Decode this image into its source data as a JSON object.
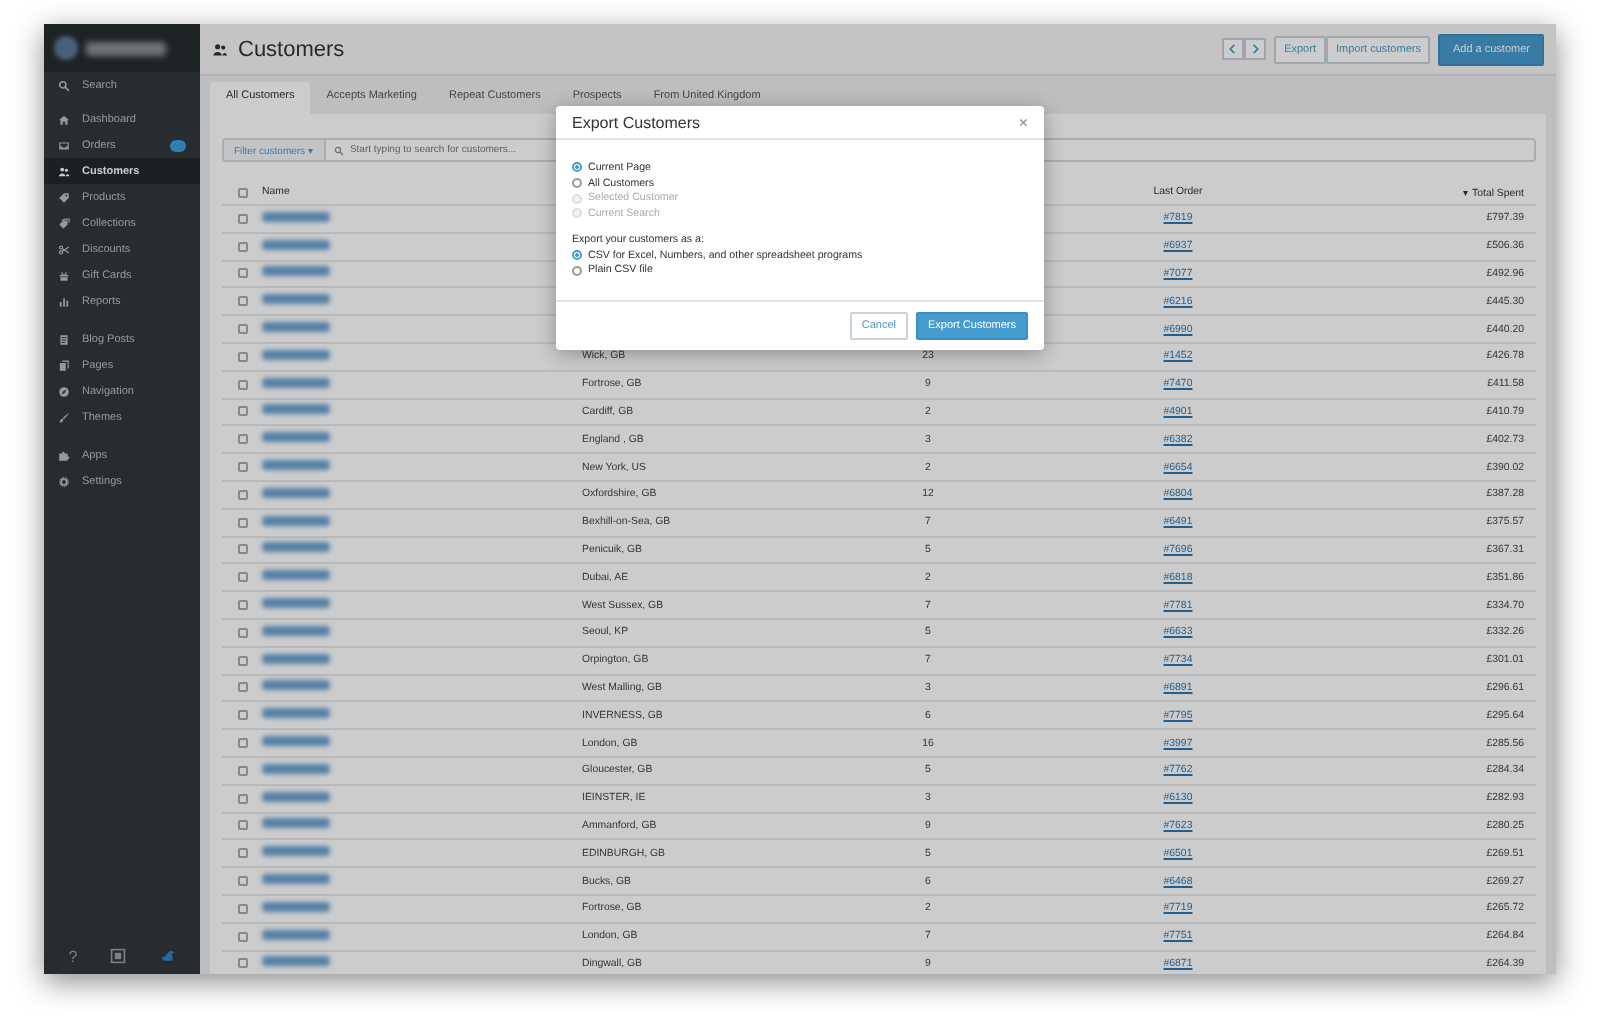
{
  "sidebar": {
    "search": "Search",
    "groups": [
      [
        {
          "label": "Dashboard",
          "selected": false,
          "badge": false
        },
        {
          "label": "Orders",
          "selected": false,
          "badge": true
        },
        {
          "label": "Customers",
          "selected": true,
          "badge": false
        },
        {
          "label": "Products",
          "selected": false,
          "badge": false
        },
        {
          "label": "Collections",
          "selected": false,
          "badge": false
        },
        {
          "label": "Discounts",
          "selected": false,
          "badge": false
        },
        {
          "label": "Gift Cards",
          "selected": false,
          "badge": false
        },
        {
          "label": "Reports",
          "selected": false,
          "badge": false
        }
      ],
      [
        {
          "label": "Blog Posts",
          "selected": false,
          "badge": false
        },
        {
          "label": "Pages",
          "selected": false,
          "badge": false
        },
        {
          "label": "Navigation",
          "selected": false,
          "badge": false
        },
        {
          "label": "Themes",
          "selected": false,
          "badge": false
        }
      ],
      [
        {
          "label": "Apps",
          "selected": false,
          "badge": false
        },
        {
          "label": "Settings",
          "selected": false,
          "badge": false
        }
      ]
    ],
    "footer_help": "?"
  },
  "header": {
    "title": "Customers",
    "buttons": [
      "Export",
      "Import customers"
    ],
    "primary_button": "Add a customer"
  },
  "tabs": [
    {
      "label": "All Customers",
      "selected": true
    },
    {
      "label": "Accepts Marketing",
      "selected": false
    },
    {
      "label": "Repeat Customers",
      "selected": false
    },
    {
      "label": "Prospects",
      "selected": false
    },
    {
      "label": "From United Kingdom",
      "selected": false
    }
  ],
  "filter": {
    "button": "Filter customers ▾",
    "placeholder": "Start typing to search for customers..."
  },
  "table": {
    "select_all_checked": false,
    "columns": [
      "Name",
      "",
      "",
      "Last Order",
      "▾ Total Spent"
    ],
    "rows": [
      {
        "checked": false,
        "location": "",
        "orders": "",
        "last_order": "#7819",
        "total": "£797.39"
      },
      {
        "checked": false,
        "location": "",
        "orders": "",
        "last_order": "#6937",
        "total": "£506.36"
      },
      {
        "checked": false,
        "location": "",
        "orders": "",
        "last_order": "#7077",
        "total": "£492.96"
      },
      {
        "checked": false,
        "location": "",
        "orders": "",
        "last_order": "#6216",
        "total": "£445.30"
      },
      {
        "checked": false,
        "location": "",
        "orders": "",
        "last_order": "#6990",
        "total": "£440.20"
      },
      {
        "checked": false,
        "location": "Wick, GB",
        "orders": "23",
        "last_order": "#1452",
        "total": "£426.78"
      },
      {
        "checked": false,
        "location": "Fortrose, GB",
        "orders": "9",
        "last_order": "#7470",
        "total": "£411.58"
      },
      {
        "checked": false,
        "location": "Cardiff, GB",
        "orders": "2",
        "last_order": "#4901",
        "total": "£410.79"
      },
      {
        "checked": false,
        "location": "England , GB",
        "orders": "3",
        "last_order": "#6382",
        "total": "£402.73"
      },
      {
        "checked": false,
        "location": "New York, US",
        "orders": "2",
        "last_order": "#6654",
        "total": "£390.02"
      },
      {
        "checked": false,
        "location": "Oxfordshire, GB",
        "orders": "12",
        "last_order": "#6804",
        "total": "£387.28"
      },
      {
        "checked": false,
        "location": "Bexhill-on-Sea, GB",
        "orders": "7",
        "last_order": "#6491",
        "total": "£375.57"
      },
      {
        "checked": false,
        "location": "Penicuik, GB",
        "orders": "5",
        "last_order": "#7696",
        "total": "£367.31"
      },
      {
        "checked": false,
        "location": "Dubai, AE",
        "orders": "2",
        "last_order": "#6818",
        "total": "£351.86"
      },
      {
        "checked": false,
        "location": "West Sussex, GB",
        "orders": "7",
        "last_order": "#7781",
        "total": "£334.70"
      },
      {
        "checked": false,
        "location": "Seoul, KP",
        "orders": "5",
        "last_order": "#6633",
        "total": "£332.26"
      },
      {
        "checked": false,
        "location": "Orpington, GB",
        "orders": "7",
        "last_order": "#7734",
        "total": "£301.01"
      },
      {
        "checked": false,
        "location": "West Malling, GB",
        "orders": "3",
        "last_order": "#6891",
        "total": "£296.61"
      },
      {
        "checked": false,
        "location": "INVERNESS, GB",
        "orders": "6",
        "last_order": "#7795",
        "total": "£295.64"
      },
      {
        "checked": false,
        "location": "London, GB",
        "orders": "16",
        "last_order": "#3997",
        "total": "£285.56"
      },
      {
        "checked": false,
        "location": "Gloucester, GB",
        "orders": "5",
        "last_order": "#7762",
        "total": "£284.34"
      },
      {
        "checked": false,
        "location": "IEINSTER, IE",
        "orders": "3",
        "last_order": "#6130",
        "total": "£282.93"
      },
      {
        "checked": false,
        "location": "Ammanford, GB",
        "orders": "9",
        "last_order": "#7623",
        "total": "£280.25"
      },
      {
        "checked": false,
        "location": "EDINBURGH, GB",
        "orders": "5",
        "last_order": "#6501",
        "total": "£269.51"
      },
      {
        "checked": false,
        "location": "Bucks, GB",
        "orders": "6",
        "last_order": "#6468",
        "total": "£269.27"
      },
      {
        "checked": false,
        "location": "Fortrose, GB",
        "orders": "2",
        "last_order": "#7719",
        "total": "£265.72"
      },
      {
        "checked": false,
        "location": "London, GB",
        "orders": "7",
        "last_order": "#7751",
        "total": "£264.84"
      },
      {
        "checked": false,
        "location": "Dingwall, GB",
        "orders": "9",
        "last_order": "#6871",
        "total": "£264.39"
      }
    ]
  },
  "dialog": {
    "title": "Export Customers",
    "close": "×",
    "scope": [
      {
        "label": "Current Page",
        "selected": true,
        "disabled": false
      },
      {
        "label": "All Customers",
        "selected": false,
        "disabled": false
      },
      {
        "label": "Selected Customer",
        "selected": false,
        "disabled": true
      },
      {
        "label": "Current Search",
        "selected": false,
        "disabled": true
      }
    ],
    "format_label": "Export your customers as a:",
    "formats": [
      {
        "label": "CSV for Excel, Numbers, and other spreadsheet programs",
        "selected": true
      },
      {
        "label": "Plain CSV file",
        "selected": false
      }
    ],
    "cancel": "Cancel",
    "confirm": "Export Customers"
  }
}
